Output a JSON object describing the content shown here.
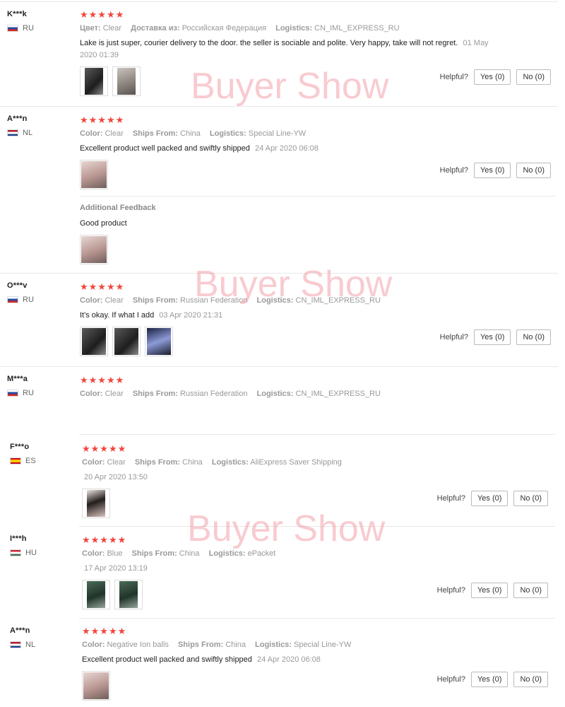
{
  "watermark": "Buyer Show",
  "helpful_label": "Helpful?",
  "reviews": [
    {
      "user": "K***k",
      "country": "RU",
      "stars": "★★★★★",
      "meta": [
        {
          "k": "Цвет:",
          "v": "Clear"
        },
        {
          "k": "Доставка из:",
          "v": "Российская Федерация"
        },
        {
          "k": "Logistics:",
          "v": "CN_IML_EXPRESS_RU"
        }
      ],
      "text": "Lake is just super, courier delivery to the door. the seller is sociable and polite. Very happy, take will not regret.",
      "date": "01 May 2020 01:39",
      "yes": "Yes (0)",
      "no": "No (0)"
    },
    {
      "user": "A***n",
      "country": "NL",
      "stars": "★★★★★",
      "meta": [
        {
          "k": "Color:",
          "v": "Clear"
        },
        {
          "k": "Ships From:",
          "v": "China"
        },
        {
          "k": "Logistics:",
          "v": "Special Line-YW"
        }
      ],
      "text": "Excellent product well packed and swiftly shipped",
      "date": "24 Apr 2020 06:08",
      "yes": "Yes (0)",
      "no": "No (0)",
      "additional_title": "Additional Feedback",
      "additional_text": "Good product"
    },
    {
      "user": "O***v",
      "country": "RU",
      "stars": "★★★★★",
      "meta": [
        {
          "k": "Color:",
          "v": "Clear"
        },
        {
          "k": "Ships From:",
          "v": "Russian Federation"
        },
        {
          "k": "Logistics:",
          "v": "CN_IML_EXPRESS_RU"
        }
      ],
      "text": "It's okay. If what I add",
      "date": "03 Apr 2020 21:31",
      "yes": "Yes (0)",
      "no": "No (0)"
    },
    {
      "user": "M***a",
      "country": "RU",
      "stars": "★★★★★",
      "meta": [
        {
          "k": "Color:",
          "v": "Clear"
        },
        {
          "k": "Ships From:",
          "v": "Russian Federation"
        },
        {
          "k": "Logistics:",
          "v": "CN_IML_EXPRESS_RU"
        }
      ]
    },
    {
      "user": "F***o",
      "country": "ES",
      "stars": "★★★★★",
      "meta": [
        {
          "k": "Color:",
          "v": "Clear"
        },
        {
          "k": "Ships From:",
          "v": "China"
        },
        {
          "k": "Logistics:",
          "v": "AliExpress Saver Shipping"
        }
      ],
      "date": "20 Apr 2020 13:50",
      "yes": "Yes (0)",
      "no": "No (0)"
    },
    {
      "user": "I***h",
      "country": "HU",
      "stars": "★★★★★",
      "meta": [
        {
          "k": "Color:",
          "v": "Blue"
        },
        {
          "k": "Ships From:",
          "v": "China"
        },
        {
          "k": "Logistics:",
          "v": "ePacket"
        }
      ],
      "date": "17 Apr 2020 13:19",
      "yes": "Yes (0)",
      "no": "No (0)"
    },
    {
      "user": "A***n",
      "country": "NL",
      "stars": "★★★★★",
      "meta": [
        {
          "k": "Color:",
          "v": "Negative Ion balls"
        },
        {
          "k": "Ships From:",
          "v": "China"
        },
        {
          "k": "Logistics:",
          "v": "Special Line-YW"
        }
      ],
      "text": "Excellent product well packed and swiftly shipped",
      "date": "24 Apr 2020 06:08",
      "yes": "Yes (0)",
      "no": "No (0)"
    }
  ]
}
